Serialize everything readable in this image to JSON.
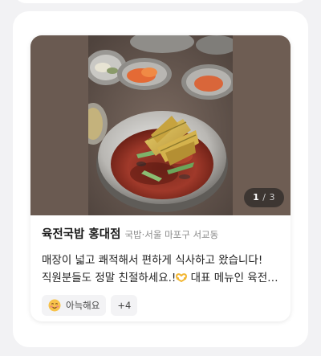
{
  "restaurant": {
    "name": "육전국밥 홍대점",
    "category": "국밥",
    "separator": "·",
    "location": "서울 마포구 서교동"
  },
  "gallery": {
    "current": "1",
    "separator": "/",
    "total": "3"
  },
  "review": {
    "line1": "매장이 넓고 쾌적해서 편하게 식사하고 왔습니다!",
    "line2_before_emoji": "직원분들도 정말 친절하세요.!",
    "line2_after_emoji": " 대표 메뉴인 육전국밥도 맛있었어요"
  },
  "tags": {
    "primary_label": "아늑해요",
    "primary_icon": "smiling-face-icon",
    "more_label": "+4"
  },
  "icons": {
    "emoji_in_review": "heart-hands-icon"
  }
}
